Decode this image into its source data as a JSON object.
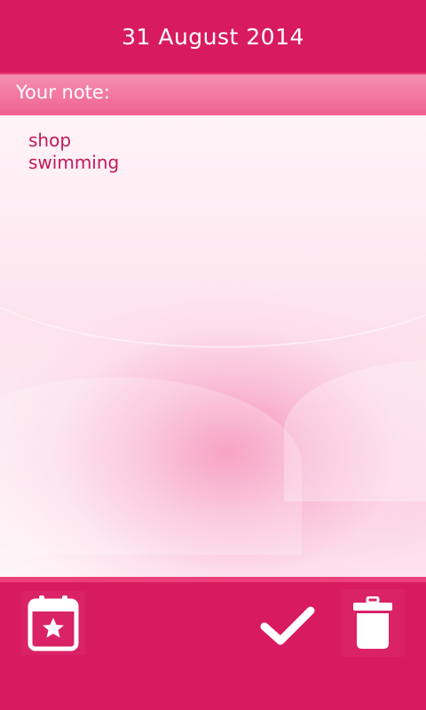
{
  "header": {
    "date": "31 August 2014"
  },
  "note": {
    "label": "Your note:",
    "text": "shop\nswimming"
  },
  "toolbar": {
    "calendar_icon": "calendar-star-icon",
    "confirm_icon": "checkmark-icon",
    "delete_icon": "trash-icon"
  },
  "colors": {
    "primary": "#d81b60",
    "label_bar": "#f06292",
    "note_text": "#c2185b"
  }
}
